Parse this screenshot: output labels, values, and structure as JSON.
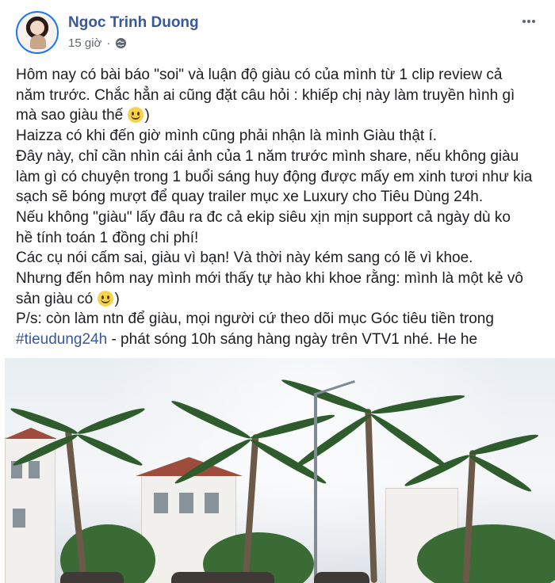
{
  "post": {
    "author": "Ngoc Trinh Duong",
    "time": "15 giờ",
    "privacy_icon": "globe-icon",
    "more_icon": "more-options-icon",
    "lines": {
      "l1": "Hôm nay có bài báo \"soi\" và luận độ giàu có của mình từ 1 clip review cả",
      "l2": "năm trước. Chắc hẳn ai cũng đặt câu hỏi : khiếp chị này làm truyền hình gì",
      "l3a": "mà sao giàu thế ",
      "l3b": ")",
      "l4": "Haizza có khi đến giờ mình cũng phải nhận là mình Giàu thật í.",
      "l5": "Đây này, chỉ cần nhìn cái ảnh của 1 năm trước mình share, nếu không giàu",
      "l6": "làm gì có chuyện trong 1 buổi sáng huy động được mấy em xinh tươi như kia",
      "l7": "sạch sẽ bóng mượt để quay trailer mục xe Luxury cho Tiêu Dùng 24h.",
      "l8": "Nếu không \"giàu\" lấy đâu ra đc cả ekip siêu xịn mịn support cả ngày dù ko",
      "l9": "hề tính toán 1 đồng chi phí!",
      "l10": "Các cụ nói cấm sai, giàu vì bạn! Và thời này kém sang có lẽ vì khoe.",
      "l11": "Nhưng đến hôm nay mình mới thấy tự hào khi khoe rằng: mình là một kẻ vô",
      "l12a": "sản giàu có ",
      "l12b": ")",
      "l13": "P/s: còn làm ntn để giàu, mọi người cứ theo dõi mục Góc tiêu tiền trong",
      "l14_hashtag": "#tieudung24h",
      "l14_rest": " - phát sóng 10h sáng hàng ngày trên VTV1 nhé. He he"
    },
    "emoji_icon": "smiling-face-icon",
    "link_color": "#385898"
  }
}
